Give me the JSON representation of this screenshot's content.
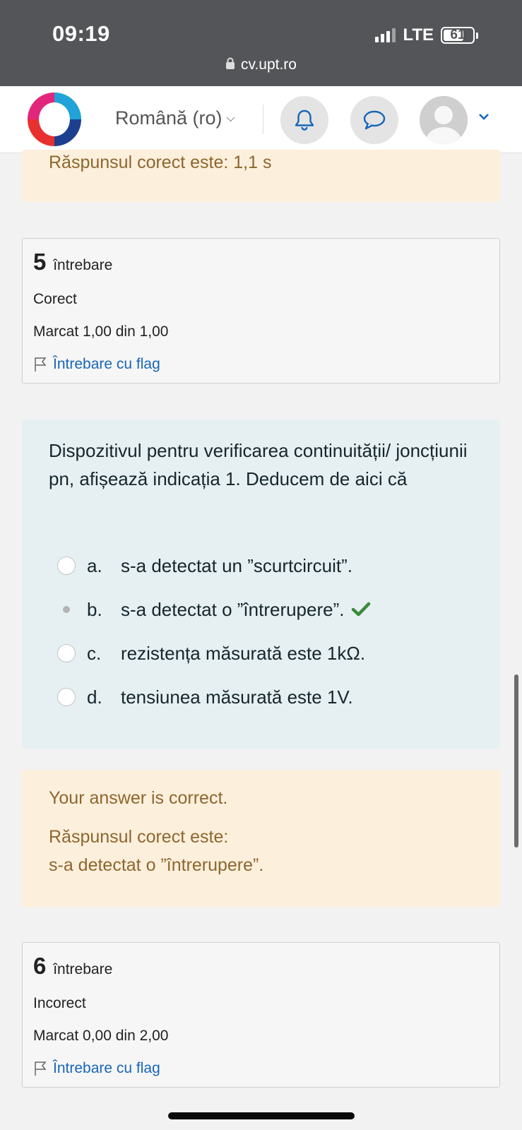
{
  "status": {
    "time": "09:19",
    "network": "LTE",
    "battery": "61",
    "url": "cv.upt.ro"
  },
  "navbar": {
    "language": "Română (ro)"
  },
  "previous_feedback": {
    "correct_answer": "Răspunsul corect este: 1,1 s"
  },
  "question5": {
    "number": "5",
    "label": "întrebare",
    "state": "Corect",
    "mark": "Marcat 1,00 din 1,00",
    "flag": "Întrebare cu flag",
    "text": "Dispozitivul pentru verificarea  continuității/ joncțiunii pn,  afișează indicația 1. Deducem de aici că",
    "answers": [
      {
        "letter": "a.",
        "text": "s-a detectat un ”scurtcircuit”."
      },
      {
        "letter": "b.",
        "text": "s-a detectat o ”întrerupere”."
      },
      {
        "letter": "c.",
        "text": "rezistența măsurată este 1kΩ."
      },
      {
        "letter": "d.",
        "text": "tensiunea măsurată este 1V."
      }
    ],
    "feedback": {
      "status": "Your answer is correct.",
      "correct_label": "Răspunsul corect este:",
      "correct_value": "s-a detectat o ”întrerupere”."
    }
  },
  "question6": {
    "number": "6",
    "label": "întrebare",
    "state": "Incorect",
    "mark": "Marcat 0,00 din 2,00",
    "flag": "Întrebare cu flag"
  },
  "colors": {
    "feedback_bg": "#fcefdc",
    "feedback_text": "#8e662e",
    "question_bg": "#e6f0f3",
    "link": "#1866b8",
    "check": "#3a8a3e"
  }
}
